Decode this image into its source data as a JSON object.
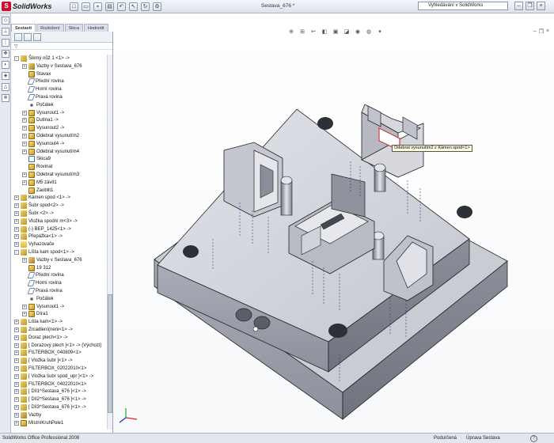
{
  "app": {
    "logo_text": "SolidWorks",
    "document_title": "Sestava_676 *",
    "search_placeholder": "Vyhledávání v SolidWorks"
  },
  "command_manager": {
    "tabs": [
      "Sestavit",
      "Rozložení",
      "Skica",
      "Hodnotit"
    ],
    "active_tab": "Sestavit"
  },
  "feature_tree": [
    {
      "label": "Šikmý nůž 1 <1> ->",
      "depth": 0,
      "toggle": "-",
      "icon": "part"
    },
    {
      "label": "Vazby v Sestava_676",
      "depth": 1,
      "toggle": "+",
      "icon": "mates"
    },
    {
      "label": "Stavax",
      "depth": 1,
      "toggle": "",
      "icon": "feature"
    },
    {
      "label": "Přední rovina",
      "depth": 1,
      "toggle": "",
      "icon": "plane"
    },
    {
      "label": "Horní rovina",
      "depth": 1,
      "toggle": "",
      "icon": "plane"
    },
    {
      "label": "Pravá rovina",
      "depth": 1,
      "toggle": "",
      "icon": "plane"
    },
    {
      "label": "Počátek",
      "depth": 1,
      "toggle": "",
      "icon": "origin"
    },
    {
      "label": "Vysunout1 ->",
      "depth": 1,
      "toggle": "+",
      "icon": "feature"
    },
    {
      "label": "Dutina1 ->",
      "depth": 1,
      "toggle": "+",
      "icon": "feature"
    },
    {
      "label": "Vysunout2 ->",
      "depth": 1,
      "toggle": "+",
      "icon": "feature"
    },
    {
      "label": "Odebrat vysunutím2",
      "depth": 1,
      "toggle": "+",
      "icon": "feature"
    },
    {
      "label": "Vysunout4 ->",
      "depth": 1,
      "toggle": "+",
      "icon": "feature"
    },
    {
      "label": "Odebrat vysunutím4",
      "depth": 1,
      "toggle": "+",
      "icon": "feature"
    },
    {
      "label": "Skica9",
      "depth": 1,
      "toggle": "",
      "icon": "sketch"
    },
    {
      "label": "Rovinat",
      "depth": 1,
      "toggle": "",
      "icon": "feature"
    },
    {
      "label": "Odebrat vysunutím3",
      "depth": 1,
      "toggle": "+",
      "icon": "feature"
    },
    {
      "label": "M5 závit1",
      "depth": 1,
      "toggle": "+",
      "icon": "feature"
    },
    {
      "label": "Zaoblit1",
      "depth": 1,
      "toggle": "",
      "icon": "feature"
    },
    {
      "label": "Kámen spod <1> ->",
      "depth": 0,
      "toggle": "+",
      "icon": "part"
    },
    {
      "label": "Šubr spod<2> ->",
      "depth": 0,
      "toggle": "+",
      "icon": "part"
    },
    {
      "label": "Šubr <2> ->",
      "depth": 0,
      "toggle": "+",
      "icon": "part"
    },
    {
      "label": "Vložka spodní m<3> ->",
      "depth": 0,
      "toggle": "+",
      "icon": "part"
    },
    {
      "label": "(-) BEP_1425<1> ->",
      "depth": 0,
      "toggle": "+",
      "icon": "part"
    },
    {
      "label": "Přepážka<1> ->",
      "depth": 0,
      "toggle": "+",
      "icon": "part"
    },
    {
      "label": "Vyhazovače",
      "depth": 0,
      "toggle": "+",
      "icon": "folder"
    },
    {
      "label": "Lišta kam spod<1> ->",
      "depth": 0,
      "toggle": "-",
      "icon": "part"
    },
    {
      "label": "Vazby v Sestava_676",
      "depth": 1,
      "toggle": "+",
      "icon": "mates"
    },
    {
      "label": "19 312",
      "depth": 1,
      "toggle": "",
      "icon": "feature"
    },
    {
      "label": "Přední rovina",
      "depth": 1,
      "toggle": "",
      "icon": "plane"
    },
    {
      "label": "Horní rovina",
      "depth": 1,
      "toggle": "",
      "icon": "plane"
    },
    {
      "label": "Pravá rovina",
      "depth": 1,
      "toggle": "",
      "icon": "plane"
    },
    {
      "label": "Počátek",
      "depth": 1,
      "toggle": "",
      "icon": "origin"
    },
    {
      "label": "Vysunout1 ->",
      "depth": 1,
      "toggle": "+",
      "icon": "feature"
    },
    {
      "label": "Díra1",
      "depth": 1,
      "toggle": "+",
      "icon": "feature"
    },
    {
      "label": "Lišta kam<1> ->",
      "depth": 0,
      "toggle": "+",
      "icon": "part"
    },
    {
      "label": "Zrcadlení(neni<1> ->",
      "depth": 0,
      "toggle": "+",
      "icon": "part"
    },
    {
      "label": "Doraz plech<1> ->",
      "depth": 0,
      "toggle": "+",
      "icon": "part"
    },
    {
      "label": "[ Dorazový plech ]<1> -> (Výchozí)",
      "depth": 0,
      "toggle": "+",
      "icon": "part"
    },
    {
      "label": "FILTERBOX_040809<1>",
      "depth": 0,
      "toggle": "+",
      "icon": "part"
    },
    {
      "label": "[ Vložka šubr ]<1> ->",
      "depth": 0,
      "toggle": "+",
      "icon": "part"
    },
    {
      "label": "FILTERBOX_02022010<1>",
      "depth": 0,
      "toggle": "+",
      "icon": "part"
    },
    {
      "label": "[ Vložka šubr spod_upr ]<1> ->",
      "depth": 0,
      "toggle": "+",
      "icon": "part"
    },
    {
      "label": "FILTERBOX_04022010<1>",
      "depth": 0,
      "toggle": "+",
      "icon": "part"
    },
    {
      "label": "[ Díl1^Sestava_676 ]<1> ->",
      "depth": 0,
      "toggle": "+",
      "icon": "part"
    },
    {
      "label": "[ Díl2^Sestava_676 ]<1> ->",
      "depth": 0,
      "toggle": "+",
      "icon": "part"
    },
    {
      "label": "[ Díl3^Sestava_676 ]<1> ->",
      "depth": 0,
      "toggle": "+",
      "icon": "part"
    },
    {
      "label": "Vazby",
      "depth": 0,
      "toggle": "+",
      "icon": "mates"
    },
    {
      "label": "MístníKruhPole1",
      "depth": 0,
      "toggle": "+",
      "icon": "feature"
    }
  ],
  "viewport": {
    "tooltip": "Odebrat vysunutím2 z Kámen spod<1>"
  },
  "statusbar": {
    "product": "SolidWorks Office Professional 2008",
    "state": "Podurčená",
    "mode": "Úprava Sestava"
  },
  "colors": {
    "part_gray": "#c9ccd4",
    "part_dark": "#7e838f",
    "highlight_red": "#d43a3a",
    "edge_black": "#1a1a1a"
  }
}
